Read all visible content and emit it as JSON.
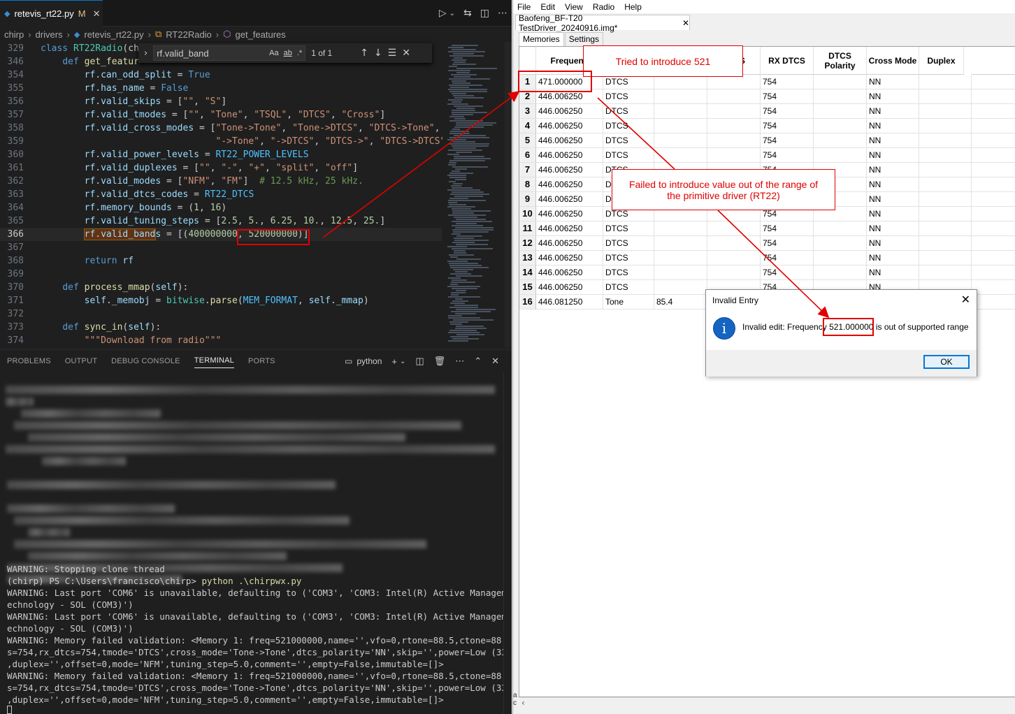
{
  "vscode": {
    "tab": {
      "icon": "python-icon",
      "filename": "retevis_rt22.py",
      "modified": "M",
      "close": "✕"
    },
    "breadcrumb": [
      "chirp",
      "drivers",
      "retevis_rt22.py",
      "RT22Radio",
      "get_features"
    ],
    "find": {
      "query": "rf.valid_band",
      "opt_case": "Aa",
      "opt_word": "ab",
      "opt_regex": ".*",
      "count": "1 of 1"
    },
    "code_lines": [
      {
        "n": "329",
        "html": "<span class='kw'>class</span> <span class='cls'>RT22Radio</span>(ch"
      },
      {
        "n": "346",
        "html": "    <span class='kw'>def</span> <span class='fn'>get_featur</span>"
      },
      {
        "n": "354",
        "html": "        <span class='var'>rf</span>.<span class='var'>can_odd_split</span> = <span class='kw'>True</span>"
      },
      {
        "n": "355",
        "html": "        <span class='var'>rf</span>.<span class='var'>has_name</span> = <span class='kw'>False</span>"
      },
      {
        "n": "356",
        "html": "        <span class='var'>rf</span>.<span class='var'>valid_skips</span> = [<span class='str'>\"\"</span>, <span class='str'>\"S\"</span>]"
      },
      {
        "n": "357",
        "html": "        <span class='var'>rf</span>.<span class='var'>valid_tmodes</span> = [<span class='str'>\"\"</span>, <span class='str'>\"Tone\"</span>, <span class='str'>\"TSQL\"</span>, <span class='str'>\"DTCS\"</span>, <span class='str'>\"Cross\"</span>]"
      },
      {
        "n": "358",
        "html": "        <span class='var'>rf</span>.<span class='var'>valid_cross_modes</span> = [<span class='str'>\"Tone->Tone\"</span>, <span class='str'>\"Tone->DTCS\"</span>, <span class='str'>\"DTCS->Tone\"</span>,"
      },
      {
        "n": "359",
        "html": "                                <span class='str'>\"->Tone\"</span>, <span class='str'>\"->DTCS\"</span>, <span class='str'>\"DTCS->\"</span>, <span class='str'>\"DTCS->DTCS\"</span>"
      },
      {
        "n": "360",
        "html": "        <span class='var'>rf</span>.<span class='var'>valid_power_levels</span> = <span class='const'>RT22_POWER_LEVELS</span>"
      },
      {
        "n": "361",
        "html": "        <span class='var'>rf</span>.<span class='var'>valid_duplexes</span> = [<span class='str'>\"\"</span>, <span class='str'>\"-\"</span>, <span class='str'>\"+\"</span>, <span class='str'>\"split\"</span>, <span class='str'>\"off\"</span>]"
      },
      {
        "n": "362",
        "html": "        <span class='var'>rf</span>.<span class='var'>valid_modes</span> = [<span class='str'>\"NFM\"</span>, <span class='str'>\"FM\"</span>]  <span class='cmt'># 12.5 kHz, 25 kHz.</span>"
      },
      {
        "n": "363",
        "html": "        <span class='var'>rf</span>.<span class='var'>valid_dtcs_codes</span> = <span class='const'>RT22_DTCS</span>"
      },
      {
        "n": "364",
        "html": "        <span class='var'>rf</span>.<span class='var'>memory_bounds</span> = (<span class='num'>1</span>, <span class='num'>16</span>)"
      },
      {
        "n": "365",
        "html": "        <span class='var'>rf</span>.<span class='var'>valid_tuning_steps</span> = [<span class='num'>2.5</span>, <span class='num'>5.</span>, <span class='num'>6.25</span>, <span class='num'>10.</span>, <span class='num'>12.5</span>, <span class='num'>25.</span>]"
      },
      {
        "n": "366",
        "html": "        <span class='hl'><span class='var'>rf</span>.<span class='var'>valid_band</span></span><span class='var'>s</span> = [(<span class='num'>400000000</span>, <span class='num'>520000000</span>)]",
        "current": true
      },
      {
        "n": "367",
        "html": ""
      },
      {
        "n": "368",
        "html": "        <span class='kw'>return</span> <span class='var'>rf</span>"
      },
      {
        "n": "369",
        "html": ""
      },
      {
        "n": "370",
        "html": "    <span class='kw'>def</span> <span class='fn'>process_mmap</span>(<span class='var'>self</span>):"
      },
      {
        "n": "371",
        "html": "        <span class='var'>self</span>.<span class='var'>_memobj</span> = <span class='cls'>bitwise</span>.<span class='fn'>parse</span>(<span class='const'>MEM_FORMAT</span>, <span class='var'>self</span>.<span class='var'>_mmap</span>)"
      },
      {
        "n": "372",
        "html": ""
      },
      {
        "n": "373",
        "html": "    <span class='kw'>def</span> <span class='fn'>sync_in</span>(<span class='var'>self</span>):"
      },
      {
        "n": "374",
        "html": "        <span class='str'>\"\"\"Download from radio\"\"\"</span>"
      }
    ],
    "panel_tabs": [
      "PROBLEMS",
      "OUTPUT",
      "DEBUG CONSOLE",
      "TERMINAL",
      "PORTS"
    ],
    "panel_active": "TERMINAL",
    "terminal_shell": "python",
    "terminal_visible": [
      {
        "text": "WARNING: Stopping clone thread"
      },
      {
        "text": "(chirp) PS C:\\Users\\francisco\\chirp> ",
        "cmd": "python .\\chirpwx.py"
      },
      {
        "text": "WARNING: Last port 'COM6' is unavailable, defaulting to ('COM3', 'COM3: Intel(R) Active Management T"
      },
      {
        "text": "echnology - SOL (COM3)')"
      },
      {
        "text": "WARNING: Last port 'COM6' is unavailable, defaulting to ('COM3', 'COM3: Intel(R) Active Management T"
      },
      {
        "text": "echnology - SOL (COM3)')"
      },
      {
        "text": "WARNING: Memory failed validation: <Memory 1: freq=521000000,name='',vfo=0,rtone=88.5,ctone=88.5,dtc"
      },
      {
        "text": "s=754,rx_dtcs=754,tmode='DTCS',cross_mode='Tone->Tone',dtcs_polarity='NN',skip='',power=Low (33 dBm)"
      },
      {
        "text": ",duplex='',offset=0,mode='NFM',tuning_step=5.0,comment='',empty=False,immutable=[]>"
      },
      {
        "text": "WARNING: Memory failed validation: <Memory 1: freq=521000000,name='',vfo=0,rtone=88.5,ctone=88.5,dtc"
      },
      {
        "text": "s=754,rx_dtcs=754,tmode='DTCS',cross_mode='Tone->Tone',dtcs_polarity='NN',skip='',power=Low (33 dBm)"
      },
      {
        "text": ",duplex='',offset=0,mode='NFM',tuning_step=5.0,comment='',empty=False,immutable=[]>"
      }
    ]
  },
  "chirp": {
    "menu": [
      "File",
      "Edit",
      "View",
      "Radio",
      "Help"
    ],
    "file_tab": "Baofeng_BF-T20 TestDriver_20240916.img*",
    "inner_tabs": [
      "Memories",
      "Settings"
    ],
    "columns": [
      "Frequenc",
      "",
      "h",
      "DTCS",
      "RX DTCS",
      "DTCS Polarity",
      "Cross Mode",
      "Duplex"
    ],
    "rows": [
      {
        "n": "1",
        "freq": "471.000000",
        "mode": "DTCS",
        "tone": "",
        "dtcs": "754",
        "pol": "NN"
      },
      {
        "n": "2",
        "freq": "446.006250",
        "mode": "DTCS",
        "tone": "",
        "dtcs": "754",
        "pol": "NN"
      },
      {
        "n": "3",
        "freq": "446.006250",
        "mode": "DTCS",
        "tone": "",
        "dtcs": "754",
        "pol": "NN"
      },
      {
        "n": "4",
        "freq": "446.006250",
        "mode": "DTCS",
        "tone": "",
        "dtcs": "754",
        "pol": "NN"
      },
      {
        "n": "5",
        "freq": "446.006250",
        "mode": "DTCS",
        "tone": "",
        "dtcs": "754",
        "pol": "NN"
      },
      {
        "n": "6",
        "freq": "446.006250",
        "mode": "DTCS",
        "tone": "",
        "dtcs": "754",
        "pol": "NN"
      },
      {
        "n": "7",
        "freq": "446.006250",
        "mode": "DTCS",
        "tone": "",
        "dtcs": "754",
        "pol": "NN"
      },
      {
        "n": "8",
        "freq": "446.006250",
        "mode": "DTCS",
        "tone": "",
        "dtcs": "754",
        "pol": "NN"
      },
      {
        "n": "9",
        "freq": "446.006250",
        "mode": "DTCS",
        "tone": "",
        "dtcs": "754",
        "pol": "NN"
      },
      {
        "n": "10",
        "freq": "446.006250",
        "mode": "DTCS",
        "tone": "",
        "dtcs": "754",
        "pol": "NN"
      },
      {
        "n": "11",
        "freq": "446.006250",
        "mode": "DTCS",
        "tone": "",
        "dtcs": "754",
        "pol": "NN"
      },
      {
        "n": "12",
        "freq": "446.006250",
        "mode": "DTCS",
        "tone": "",
        "dtcs": "754",
        "pol": "NN"
      },
      {
        "n": "13",
        "freq": "446.006250",
        "mode": "DTCS",
        "tone": "",
        "dtcs": "754",
        "pol": "NN"
      },
      {
        "n": "14",
        "freq": "446.006250",
        "mode": "DTCS",
        "tone": "",
        "dtcs": "754",
        "pol": "NN"
      },
      {
        "n": "15",
        "freq": "446.006250",
        "mode": "DTCS",
        "tone": "",
        "dtcs": "754",
        "pol": "NN"
      },
      {
        "n": "16",
        "freq": "446.081250",
        "mode": "Tone",
        "tone": "85.4",
        "dtcs": "",
        "pol": ""
      }
    ],
    "side_fragment": "a\nc"
  },
  "dialog": {
    "title": "Invalid Entry",
    "close": "✕",
    "icon": "info-icon",
    "message_pre": "Invalid edit: Frequency ",
    "message_value": "521.000000",
    "message_post": " is out of supported range",
    "ok": "OK"
  },
  "callouts": {
    "top": "Tried to introduce 521",
    "middle": "Failed to introduce value out of the range of the primitive driver (RT22)"
  },
  "colors": {
    "annotation_red": "#e00000",
    "vscode_bg": "#1f1f1f",
    "info_blue": "#1565c0"
  }
}
